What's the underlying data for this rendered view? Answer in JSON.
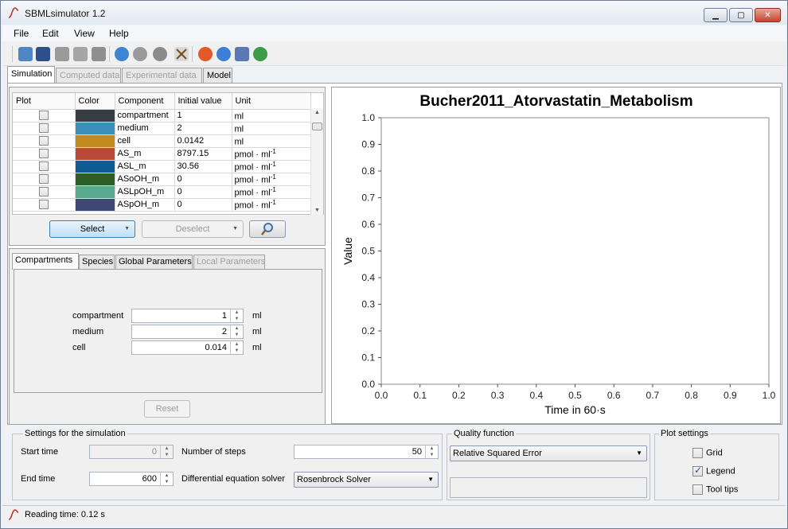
{
  "window": {
    "title": "SBMLsimulator 1.2"
  },
  "menu": [
    "File",
    "Edit",
    "View",
    "Help"
  ],
  "toolbar_icons": [
    "open-folder-icon",
    "save-icon",
    "print-icon",
    "export-icon",
    "delete-icon",
    "run-icon",
    "stop-icon",
    "spiral-icon",
    "tools-icon",
    "help-lifebuoy-icon",
    "info-icon",
    "license-icon",
    "web-icon"
  ],
  "main_tabs": [
    {
      "label": "Simulation",
      "active": true,
      "disabled": false
    },
    {
      "label": "Computed data",
      "active": false,
      "disabled": true
    },
    {
      "label": "Experimental data",
      "active": false,
      "disabled": true
    },
    {
      "label": "Model",
      "active": false,
      "disabled": false
    }
  ],
  "component_table": {
    "headers": [
      "Plot",
      "Color",
      "Component",
      "Initial value",
      "Unit"
    ],
    "rows": [
      {
        "color": "#373c42",
        "component": "compartment",
        "value": "1",
        "unit": "ml",
        "sup": ""
      },
      {
        "color": "#3b8fb9",
        "component": "medium",
        "value": "2",
        "unit": "ml",
        "sup": ""
      },
      {
        "color": "#c08a1e",
        "component": "cell",
        "value": "0.0142",
        "unit": "ml",
        "sup": ""
      },
      {
        "color": "#b84a3a",
        "component": "AS_m",
        "value": "8797.15",
        "unit": "pmol · ml",
        "sup": "-1"
      },
      {
        "color": "#0f5c95",
        "component": "ASL_m",
        "value": "30.56",
        "unit": "pmol · ml",
        "sup": "-1"
      },
      {
        "color": "#2c5f26",
        "component": "ASoOH_m",
        "value": "0",
        "unit": "pmol · ml",
        "sup": "-1"
      },
      {
        "color": "#5aa88e",
        "component": "ASLpOH_m",
        "value": "0",
        "unit": "pmol · ml",
        "sup": "-1"
      },
      {
        "color": "#3d4a75",
        "component": "ASpOH_m",
        "value": "0",
        "unit": "pmol · ml",
        "sup": "-1"
      }
    ]
  },
  "select_button": "Select",
  "deselect_button": "Deselect",
  "sub_tabs": [
    {
      "label": "Compartments",
      "active": true,
      "disabled": false
    },
    {
      "label": "Species",
      "active": false,
      "disabled": false
    },
    {
      "label": "Global Parameters",
      "active": false,
      "disabled": false
    },
    {
      "label": "Local Parameters",
      "active": false,
      "disabled": true
    }
  ],
  "compartments": [
    {
      "name": "compartment",
      "value": "1",
      "unit": "ml"
    },
    {
      "name": "medium",
      "value": "2",
      "unit": "ml"
    },
    {
      "name": "cell",
      "value": "0.014",
      "unit": "ml"
    }
  ],
  "reset_button": "Reset",
  "chart_data": {
    "type": "line",
    "title": "Bucher2011_Atorvastatin_Metabolism",
    "xlabel": "Time in 60·s",
    "ylabel": "Value",
    "xlim": [
      0,
      1
    ],
    "ylim": [
      0,
      1
    ],
    "xticks": [
      "0.0",
      "0.1",
      "0.2",
      "0.3",
      "0.4",
      "0.5",
      "0.6",
      "0.7",
      "0.8",
      "0.9",
      "1.0"
    ],
    "yticks": [
      "0.0",
      "0.1",
      "0.2",
      "0.3",
      "0.4",
      "0.5",
      "0.6",
      "0.7",
      "0.8",
      "0.9",
      "1.0"
    ],
    "series": [],
    "grid": false
  },
  "simulation_settings": {
    "title": "Settings for the simulation",
    "start_time_label": "Start time",
    "start_time_value": "0",
    "end_time_label": "End time",
    "end_time_value": "600",
    "steps_label": "Number of steps",
    "steps_value": "50",
    "solver_label": "Differential equation solver",
    "solver_value": "Rosenbrock Solver"
  },
  "quality_function": {
    "title": "Quality function",
    "value": "Relative Squared Error"
  },
  "plot_settings": {
    "title": "Plot settings",
    "options": [
      {
        "label": "Grid",
        "checked": false
      },
      {
        "label": "Legend",
        "checked": true
      },
      {
        "label": "Tool tips",
        "checked": false
      }
    ]
  },
  "status": {
    "text": "Reading time: 0.12 s"
  }
}
